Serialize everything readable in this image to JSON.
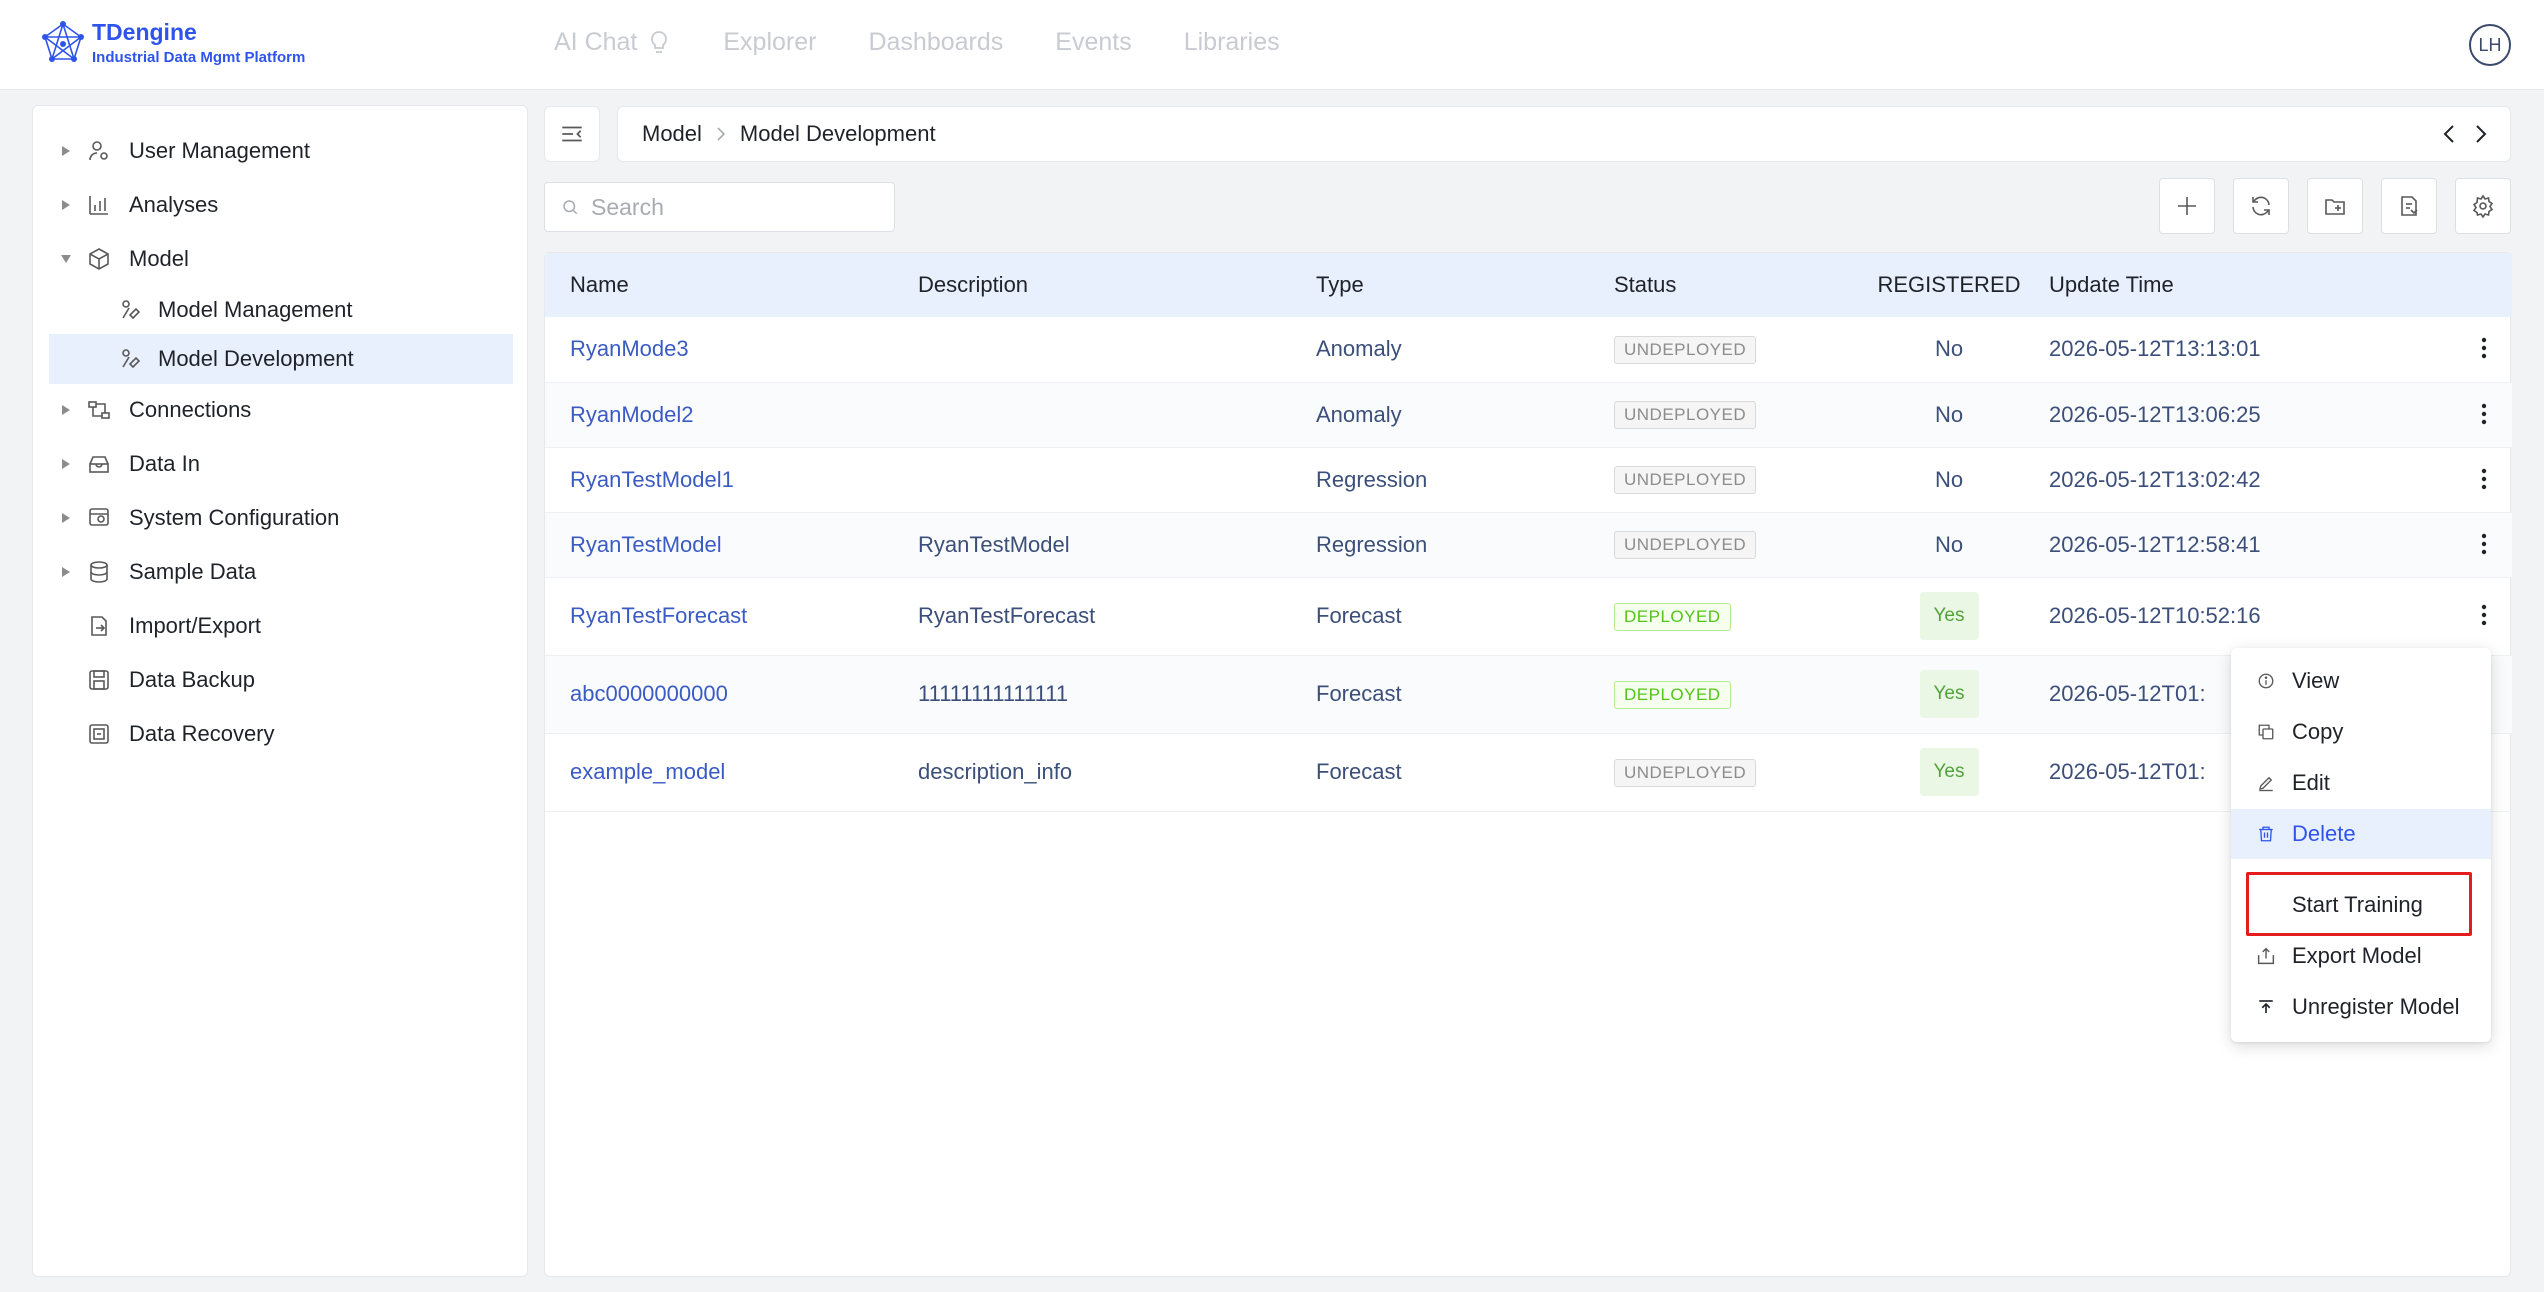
{
  "header": {
    "logo_title": "TDengine",
    "logo_subtitle": "Industrial Data Mgmt Platform",
    "nav": [
      {
        "label": "AI Chat",
        "icon": "lightbulb-icon"
      },
      {
        "label": "Explorer"
      },
      {
        "label": "Dashboards"
      },
      {
        "label": "Events"
      },
      {
        "label": "Libraries"
      }
    ],
    "avatar_initials": "LH"
  },
  "sidebar": {
    "items": [
      {
        "label": "User Management",
        "icon": "user-settings-icon",
        "expandable": true
      },
      {
        "label": "Analyses",
        "icon": "analytics-icon",
        "expandable": true
      },
      {
        "label": "Model",
        "icon": "cube-icon",
        "expandable": true,
        "expanded": true
      },
      {
        "label": "Model Management",
        "icon": "model-icon",
        "child": true
      },
      {
        "label": "Model Development",
        "icon": "model-icon",
        "child": true,
        "selected": true
      },
      {
        "label": "Connections",
        "icon": "connections-icon",
        "expandable": true
      },
      {
        "label": "Data In",
        "icon": "data-in-icon",
        "expandable": true
      },
      {
        "label": "System Configuration",
        "icon": "system-config-icon",
        "expandable": true
      },
      {
        "label": "Sample Data",
        "icon": "database-icon",
        "expandable": true
      },
      {
        "label": "Import/Export",
        "icon": "import-export-icon"
      },
      {
        "label": "Data Backup",
        "icon": "backup-icon"
      },
      {
        "label": "Data Recovery",
        "icon": "recovery-icon"
      }
    ]
  },
  "breadcrumb": {
    "items": [
      "Model",
      "Model Development"
    ]
  },
  "search": {
    "placeholder": "Search",
    "value": ""
  },
  "toolbar": [
    "add-icon",
    "refresh-icon",
    "import-folder-icon",
    "export-file-icon",
    "settings-icon"
  ],
  "table": {
    "columns": [
      "Name",
      "Description",
      "Type",
      "Status",
      "REGISTERED",
      "Update Time"
    ],
    "rows": [
      {
        "name": "RyanMode3",
        "description": "",
        "type": "Anomaly",
        "status": "UNDEPLOYED",
        "registered": "No",
        "update_time": "2026-05-12T13:13:01"
      },
      {
        "name": "RyanModel2",
        "description": "",
        "type": "Anomaly",
        "status": "UNDEPLOYED",
        "registered": "No",
        "update_time": "2026-05-12T13:06:25"
      },
      {
        "name": "RyanTestModel1",
        "description": "",
        "type": "Regression",
        "status": "UNDEPLOYED",
        "registered": "No",
        "update_time": "2026-05-12T13:02:42"
      },
      {
        "name": "RyanTestModel",
        "description": "RyanTestModel",
        "type": "Regression",
        "status": "UNDEPLOYED",
        "registered": "No",
        "update_time": "2026-05-12T12:58:41"
      },
      {
        "name": "RyanTestForecast",
        "description": "RyanTestForecast",
        "type": "Forecast",
        "status": "DEPLOYED",
        "registered": "Yes",
        "update_time": "2026-05-12T10:52:16"
      },
      {
        "name": "abc0000000000",
        "description": "11111111111111",
        "type": "Forecast",
        "status": "DEPLOYED",
        "registered": "Yes",
        "update_time": "2026-05-12T01:"
      },
      {
        "name": "example_model",
        "description": "description_info",
        "type": "Forecast",
        "status": "UNDEPLOYED",
        "registered": "Yes",
        "update_time": "2026-05-12T01:"
      }
    ]
  },
  "context_menu": {
    "items": [
      {
        "label": "View",
        "icon": "info-icon"
      },
      {
        "label": "Copy",
        "icon": "copy-icon"
      },
      {
        "label": "Edit",
        "icon": "edit-icon"
      },
      {
        "label": "Delete",
        "icon": "trash-icon",
        "active": true
      },
      {
        "label": "Start Training",
        "icon": ""
      },
      {
        "label": "Export Model",
        "icon": "export-icon"
      },
      {
        "label": "Unregister Model",
        "icon": "unregister-icon"
      }
    ],
    "highlight_color": "#e31d1d",
    "accent_color": "#2f54eb"
  }
}
